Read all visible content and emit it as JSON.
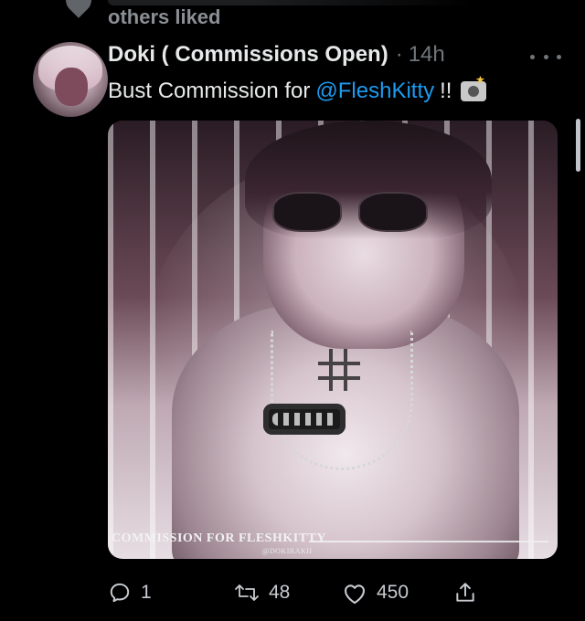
{
  "social_context": {
    "text": "others liked"
  },
  "tweet": {
    "author_name": "Doki ( Commissions Open)",
    "separator": "·",
    "timestamp": "14h",
    "text_prefix": "Bust Commission for",
    "mention": "@FleshKitty",
    "text_suffix": "!!",
    "emoji_icon": "camera-with-flash-icon"
  },
  "media": {
    "watermark_text": "COMMISSION FOR FLESHKITTY",
    "watermark_sub": "@DOKIRAKII"
  },
  "actions": {
    "reply_count": "1",
    "retweet_count": "48",
    "like_count": "450"
  },
  "icons": {
    "reply": "reply-icon",
    "retweet": "retweet-icon",
    "like": "heart-icon",
    "share": "share-icon",
    "more": "more-horizontal-icon"
  },
  "colors": {
    "background": "#000000",
    "text_primary": "#e7e9ea",
    "text_secondary": "#71767b",
    "link": "#1d9bf0"
  }
}
